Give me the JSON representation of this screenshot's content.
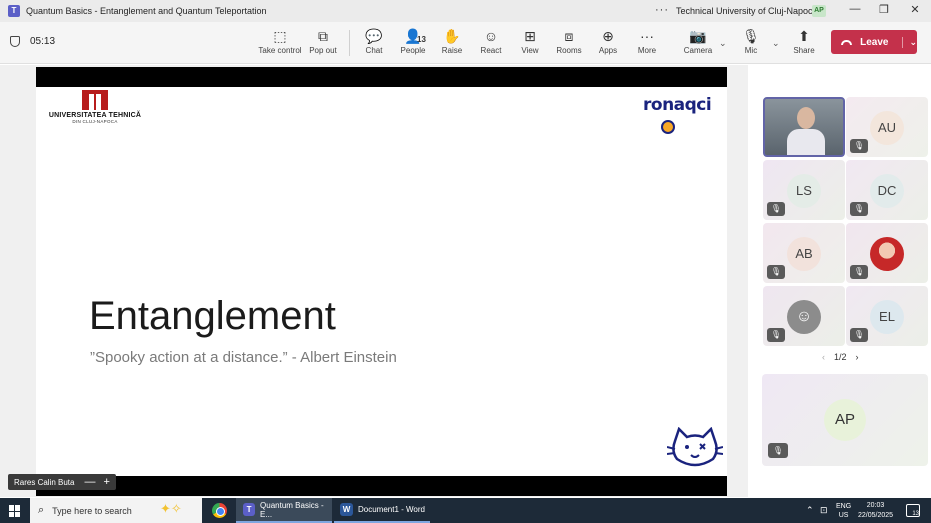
{
  "window": {
    "title": "Quantum Basics - Entanglement and Quantum Teleportation",
    "more": "···",
    "org": "Technical University of Cluj-Napoca",
    "user_badge": "AP",
    "controls": [
      "—",
      "❐",
      "✕"
    ]
  },
  "meeting": {
    "timer": "05:13",
    "toolbar": [
      {
        "label": "Take control",
        "icon": "take-control-icon",
        "glyph": "⬚"
      },
      {
        "label": "Pop out",
        "icon": "pop-out-icon",
        "glyph": "⧉"
      },
      {
        "label": "Chat",
        "icon": "chat-icon",
        "glyph": "💬"
      },
      {
        "label": "People",
        "icon": "people-icon",
        "glyph": "👤",
        "count": "13"
      },
      {
        "label": "Raise",
        "icon": "raise-hand-icon",
        "glyph": "✋"
      },
      {
        "label": "React",
        "icon": "react-icon",
        "glyph": "☺"
      },
      {
        "label": "View",
        "icon": "view-icon",
        "glyph": "⊞"
      },
      {
        "label": "Rooms",
        "icon": "rooms-icon",
        "glyph": "⧈"
      },
      {
        "label": "Apps",
        "icon": "apps-icon",
        "glyph": "⊕"
      },
      {
        "label": "More",
        "icon": "more-icon",
        "glyph": "···"
      },
      {
        "label": "Camera",
        "icon": "camera-off-icon",
        "glyph": "📷"
      },
      {
        "label": "Mic",
        "icon": "mic-off-icon",
        "glyph": "🎙"
      },
      {
        "label": "Share",
        "icon": "share-icon",
        "glyph": "⬆"
      }
    ],
    "leave_label": "Leave",
    "leave_color": "#c4314b"
  },
  "slide": {
    "university_name": "UNIVERSITATEA TEHNICĂ",
    "university_city": "DIN CLUJ-NAPOCA",
    "partner_logo": "ronaqci",
    "title": "Entanglement",
    "quote": "”Spooky action at a distance.” - Albert Einstein",
    "presenter": "Rares Calin Buta",
    "presenter_controls": [
      "—",
      "+"
    ]
  },
  "participants": [
    {
      "initials": "",
      "video": true,
      "name_hint": "presenter-video"
    },
    {
      "initials": "AU",
      "muted": true
    },
    {
      "initials": "LS",
      "muted": true
    },
    {
      "initials": "DC",
      "muted": true
    },
    {
      "initials": "AB",
      "muted": true
    },
    {
      "initials": "",
      "photo": true,
      "muted": true
    },
    {
      "initials": "",
      "generic": true,
      "muted": true
    },
    {
      "initials": "EL",
      "muted": true
    }
  ],
  "pager": {
    "text": "1/2",
    "prev": "‹",
    "next": "›"
  },
  "featured": {
    "initials": "AP",
    "muted": true
  },
  "taskbar": {
    "search_placeholder": "Type here to search",
    "apps": [
      {
        "label": "Quantum Basics - E...",
        "icon": "teams-icon",
        "active": true
      },
      {
        "label": "Document1 - Word",
        "icon": "word-icon",
        "active": false
      }
    ],
    "language": "ENG",
    "region": "US",
    "time": "20:03",
    "date": "22/05/2025",
    "notifications": "13"
  }
}
